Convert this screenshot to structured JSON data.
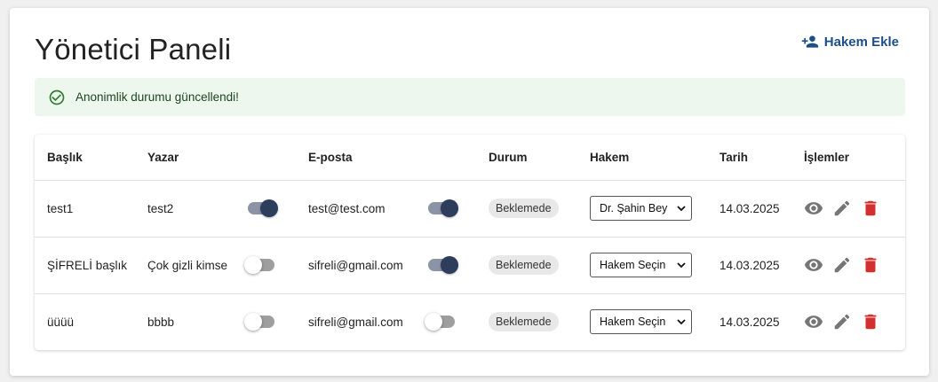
{
  "header": {
    "title": "Yönetici Paneli",
    "add_referee_label": "Hakem Ekle"
  },
  "alert": {
    "message": "Anonimlik durumu güncellendi!",
    "color": "#edf7ed"
  },
  "table": {
    "columns": {
      "title": "Başlık",
      "author": "Yazar",
      "email": "E-posta",
      "status": "Durum",
      "referee": "Hakem",
      "date": "Tarih",
      "actions": "İşlemler"
    },
    "rows": [
      {
        "title": "test1",
        "author": "test2",
        "author_anonymous": true,
        "email": "test@test.com",
        "email_anonymous": true,
        "status": "Beklemede",
        "referee": "Dr. Şahin Bey",
        "date": "14.03.2025"
      },
      {
        "title": "ŞİFRELİ başlık",
        "author": "Çok gizli kimse",
        "author_anonymous": false,
        "email": "sifreli@gmail.com",
        "email_anonymous": true,
        "status": "Beklemede",
        "referee": "Hakem Seçin",
        "date": "14.03.2025"
      },
      {
        "title": "üüüü",
        "author": "bbbb",
        "author_anonymous": false,
        "email": "sifreli@gmail.com",
        "email_anonymous": false,
        "status": "Beklemede",
        "referee": "Hakem Seçin",
        "date": "14.03.2025"
      }
    ]
  },
  "icons": {
    "add_person": "person-add-icon",
    "success": "check-circle-icon",
    "view": "eye-icon",
    "edit": "pencil-icon",
    "delete": "trash-icon"
  },
  "colors": {
    "accent": "#1d4e89",
    "toggle_on": "#2c3e5c",
    "delete": "#d32f2f",
    "action_gray": "#757575"
  }
}
